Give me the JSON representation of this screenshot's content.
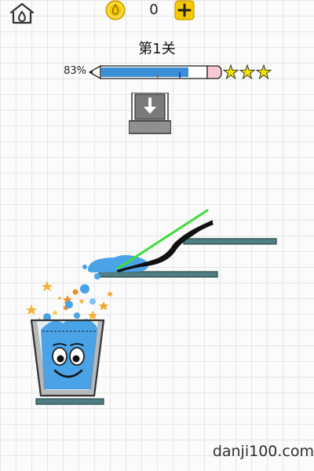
{
  "header": {
    "home_icon": "home-icon",
    "coin_icon": "droplet-coin-icon",
    "coin_count": "0",
    "add_icon": "plus-icon"
  },
  "level": {
    "title": "第1关"
  },
  "progress": {
    "percent_label": "83%",
    "value": 0.83,
    "stars": 3
  },
  "drop_button": {
    "icon": "down-arrow-icon"
  },
  "watermark": "danji100.com",
  "colors": {
    "coin": "#f5c800",
    "water": "#4aa3e6",
    "water_light": "#7cc3f2",
    "platform": "#4f7f83",
    "drawn_line": "#111111",
    "laser": "#3ddc3d",
    "star": "#f2e000",
    "pencil_eraser": "#f7c9d4"
  }
}
